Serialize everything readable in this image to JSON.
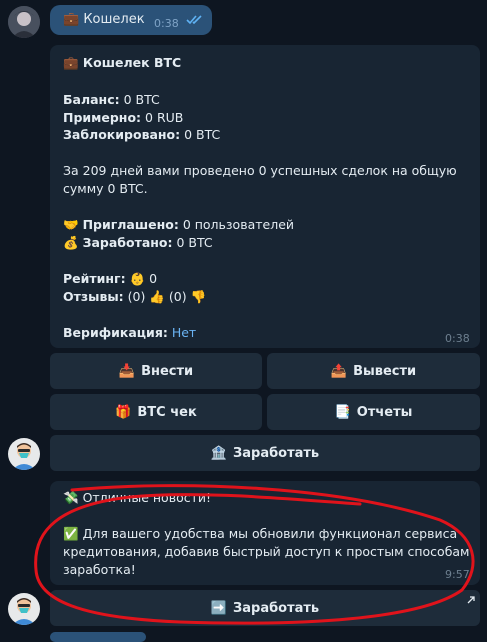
{
  "top": {
    "message": "💼 Кошелек",
    "time": "0:38"
  },
  "wallet": {
    "title": "💼 Кошелек BTC",
    "balance_label": "Баланс:",
    "balance_value": "0 BTC",
    "approx_label": "Примерно:",
    "approx_value": "0 RUB",
    "blocked_label": "Заблокировано:",
    "blocked_value": "0 BTC",
    "stats_line1": "За 209 дней вами проведено 0 успешных сделок на общую",
    "stats_line2": "сумму 0 BTC.",
    "invited_icon": "🤝",
    "invited_label": "Приглашено:",
    "invited_value": "0 пользователей",
    "earned_icon": "💰",
    "earned_label": "Заработано:",
    "earned_value": "0 BTC",
    "rating_label": "Рейтинг:",
    "rating_icon": "👶",
    "rating_value": "0",
    "reviews_label": "Отзывы:",
    "reviews_pos": "(0)",
    "thumb_up": "👍",
    "reviews_neg": "(0)",
    "thumb_down": "👎",
    "verification_label": "Верификация:",
    "verification_value": "Нет",
    "time": "0:38"
  },
  "keyboard": {
    "deposit": {
      "icon": "📥",
      "label": "Внести"
    },
    "withdraw": {
      "icon": "📤",
      "label": "Вывести"
    },
    "btc_check": {
      "icon": "🎁",
      "label": "BTC чек"
    },
    "reports": {
      "icon": "📑",
      "label": "Отчеты"
    },
    "earn": {
      "icon": "🏦",
      "label": "Заработать"
    }
  },
  "news": {
    "header_icon": "💸",
    "header": "Отличные новости!",
    "check_icon": "✅",
    "line1": "Для вашего удобства мы обновили функционал сервиса",
    "line2": "кредитования, добавив быстрый доступ к простым способам",
    "line3": "заработка!",
    "time": "9:57",
    "button": {
      "icon": "➡️",
      "label": "Заработать"
    }
  },
  "colors": {
    "background": "#0e1621",
    "bubble": "#182533",
    "outgoing": "#2b5278",
    "link": "#6ab3f3",
    "annotation": "#e0131b"
  }
}
